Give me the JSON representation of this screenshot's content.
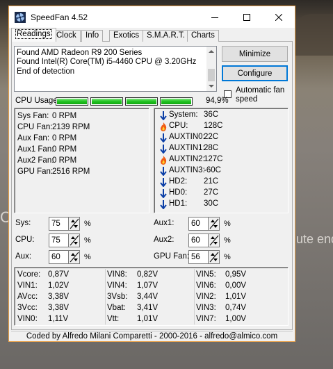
{
  "window": {
    "title": "SpeedFan 4.52",
    "accent_color": "#e9a14a"
  },
  "desktop": {
    "text_left": "C",
    "text_right": "ute end"
  },
  "tabs": [
    {
      "label": "Readings",
      "active": true
    },
    {
      "label": "Clock"
    },
    {
      "label": "Info"
    },
    {
      "label": "Exotics"
    },
    {
      "label": "S.M.A.R.T."
    },
    {
      "label": "Charts"
    }
  ],
  "log": {
    "lines": [
      "Found AMD Radeon R9 200 Series",
      "Found Intel(R) Core(TM) i5-4460 CPU @ 3.20GHz",
      "End of detection"
    ]
  },
  "buttons": {
    "minimize": "Minimize",
    "configure": "Configure"
  },
  "auto_fan": {
    "label": "Automatic fan speed",
    "checked": false
  },
  "cpu_usage": {
    "label": "CPU Usage",
    "value": "94,9%",
    "cores": [
      1,
      1,
      1,
      1
    ]
  },
  "fans": [
    {
      "name": "Sys Fan:",
      "value": "0 RPM"
    },
    {
      "name": "CPU Fan:",
      "value": "2139 RPM"
    },
    {
      "name": "Aux Fan:",
      "value": "0 RPM"
    },
    {
      "name": "Aux1 Fan:",
      "value": "0 RPM"
    },
    {
      "name": "Aux2 Fan:",
      "value": "0 RPM"
    },
    {
      "name": "GPU Fan:",
      "value": "2516 RPM"
    }
  ],
  "temps": [
    {
      "name": "System:",
      "value": "36C",
      "icon": "down-arrow-icon"
    },
    {
      "name": "CPU:",
      "value": "128C",
      "icon": "flame-icon"
    },
    {
      "name": "AUXTIN0:",
      "value": "22C",
      "icon": "down-arrow-icon"
    },
    {
      "name": "AUXTIN1:",
      "value": "28C",
      "icon": "down-arrow-icon"
    },
    {
      "name": "AUXTIN2:",
      "value": "127C",
      "icon": "flame-icon"
    },
    {
      "name": "AUXTIN3:",
      "value": "-60C",
      "icon": "down-arrow-icon"
    },
    {
      "name": "HD2:",
      "value": "21C",
      "icon": "down-arrow-icon"
    },
    {
      "name": "HD0:",
      "value": "27C",
      "icon": "down-arrow-icon"
    },
    {
      "name": "HD1:",
      "value": "30C",
      "icon": "down-arrow-icon"
    }
  ],
  "speeds": {
    "sys": {
      "label": "Sys:",
      "value": "75",
      "unit": "%"
    },
    "cpu": {
      "label": "CPU:",
      "value": "75",
      "unit": "%"
    },
    "aux": {
      "label": "Aux:",
      "value": "60",
      "unit": "%"
    },
    "aux1": {
      "label": "Aux1:",
      "value": "60",
      "unit": "%"
    },
    "aux2": {
      "label": "Aux2:",
      "value": "60",
      "unit": "%"
    },
    "gpu": {
      "label": "GPU Fan:",
      "value": "56",
      "unit": "%"
    }
  },
  "voltages": [
    [
      {
        "name": "Vcore:",
        "value": "0,87V"
      },
      {
        "name": "VIN1:",
        "value": "1,02V"
      },
      {
        "name": "AVcc:",
        "value": "3,38V"
      },
      {
        "name": "3Vcc:",
        "value": "3,38V"
      },
      {
        "name": "VIN0:",
        "value": "1,11V"
      }
    ],
    [
      {
        "name": "VIN8:",
        "value": "0,82V"
      },
      {
        "name": "VIN4:",
        "value": "1,07V"
      },
      {
        "name": "3Vsb:",
        "value": "3,44V"
      },
      {
        "name": "Vbat:",
        "value": "3,41V"
      },
      {
        "name": "Vtt:",
        "value": "1,01V"
      }
    ],
    [
      {
        "name": "VIN5:",
        "value": "0,95V"
      },
      {
        "name": "VIN6:",
        "value": "0,00V"
      },
      {
        "name": "VIN2:",
        "value": "1,01V"
      },
      {
        "name": "VIN3:",
        "value": "0,74V"
      },
      {
        "name": "VIN7:",
        "value": "1,00V"
      }
    ]
  ],
  "status_bar": "Coded by Alfredo Milani Comparetti - 2000-2016 - alfredo@almico.com"
}
